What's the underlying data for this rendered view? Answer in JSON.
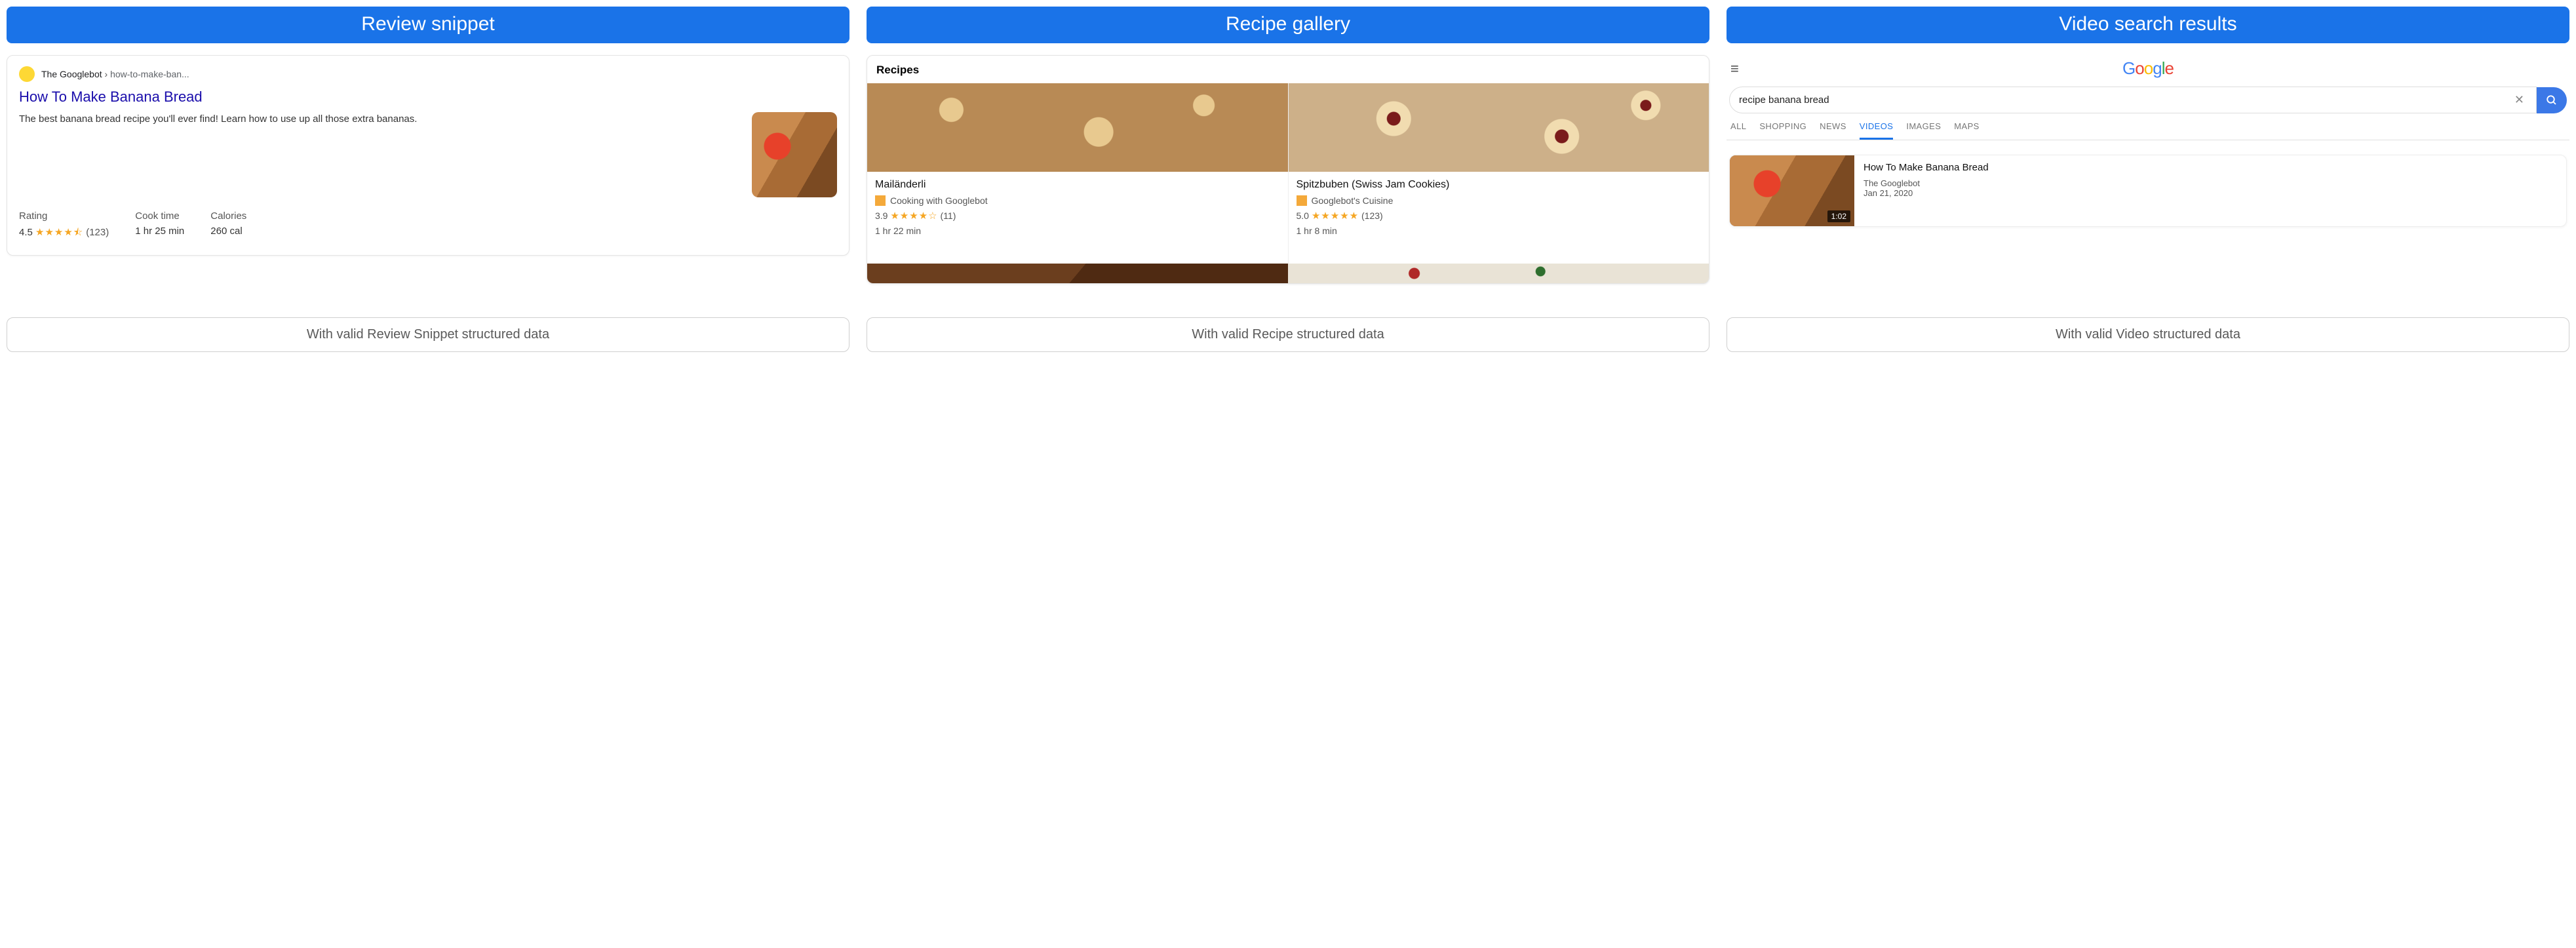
{
  "columns": {
    "c0": {
      "header": "Review snippet",
      "footer": "With valid Review Snippet structured data"
    },
    "c1": {
      "header": "Recipe gallery",
      "footer": "With valid Recipe structured data"
    },
    "c2": {
      "header": "Video search results",
      "footer": "With valid Video structured data"
    }
  },
  "review": {
    "site": "The Googlebot",
    "path_sep": " › ",
    "path": "how-to-make-ban...",
    "title": "How To Make Banana Bread",
    "description": "The best banana bread recipe you'll ever find! Learn how to use up all those extra bananas.",
    "meta": {
      "rating_label": "Rating",
      "rating_value": "4.5",
      "rating_stars": "★★★★⯪",
      "rating_count": "(123)",
      "cook_label": "Cook time",
      "cook_value": "1 hr 25 min",
      "cal_label": "Calories",
      "cal_value": "260 cal"
    }
  },
  "gallery": {
    "heading": "Recipes",
    "items": {
      "i0": {
        "name": "Mailänderli",
        "source": "Cooking with Googlebot",
        "rating_value": "3.9",
        "rating_stars": "★★★★☆",
        "rating_count": "(11)",
        "time": "1 hr 22 min"
      },
      "i1": {
        "name": "Spitzbuben (Swiss Jam Cookies)",
        "source": "Googlebot's Cuisine",
        "rating_value": "5.0",
        "rating_stars": "★★★★★",
        "rating_count": "(123)",
        "time": "1 hr 8 min"
      }
    }
  },
  "video": {
    "query": "recipe banana bread",
    "tabs": {
      "t0": "ALL",
      "t1": "SHOPPING",
      "t2": "NEWS",
      "t3": "VIDEOS",
      "t4": "IMAGES",
      "t5": "MAPS"
    },
    "result": {
      "title": "How To Make Banana Bread",
      "source": "The Googlebot",
      "date": "Jan 21, 2020",
      "duration": "1:02"
    }
  }
}
